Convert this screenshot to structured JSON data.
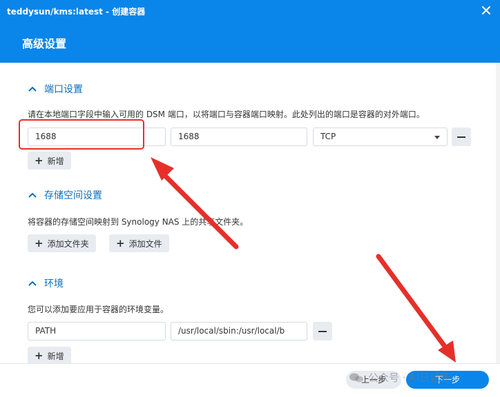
{
  "window": {
    "title": "teddysun/kms:latest - 创建容器"
  },
  "header": {
    "title": "高级设置"
  },
  "ports": {
    "title": "端口设置",
    "description": "请在本地端口字段中输入可用的 DSM 端口，以将端口与容器端口映射。此处列出的端口是容器的对外端口。",
    "rows": [
      {
        "local_port": "1688",
        "container_port": "1688",
        "protocol": "TCP"
      }
    ],
    "add_label": "新增"
  },
  "storage": {
    "title": "存储空间设置",
    "description": "将容器的存储空间映射到 Synology NAS 上的共享文件夹。",
    "add_folder_label": "添加文件夹",
    "add_file_label": "添加文件"
  },
  "environment": {
    "title": "环境",
    "description": "您可以添加要应用于容器的环境变量。",
    "rows": [
      {
        "name": "PATH",
        "value": "/usr/local/sbin:/usr/local/b"
      }
    ],
    "add_label": "新增"
  },
  "footer": {
    "prev_label": "上一步",
    "next_label": "下一步"
  },
  "watermark": {
    "text": "公众号 · AI日记哇"
  },
  "colors": {
    "accent": "#0a85e9",
    "annotation": "#e5302a"
  }
}
